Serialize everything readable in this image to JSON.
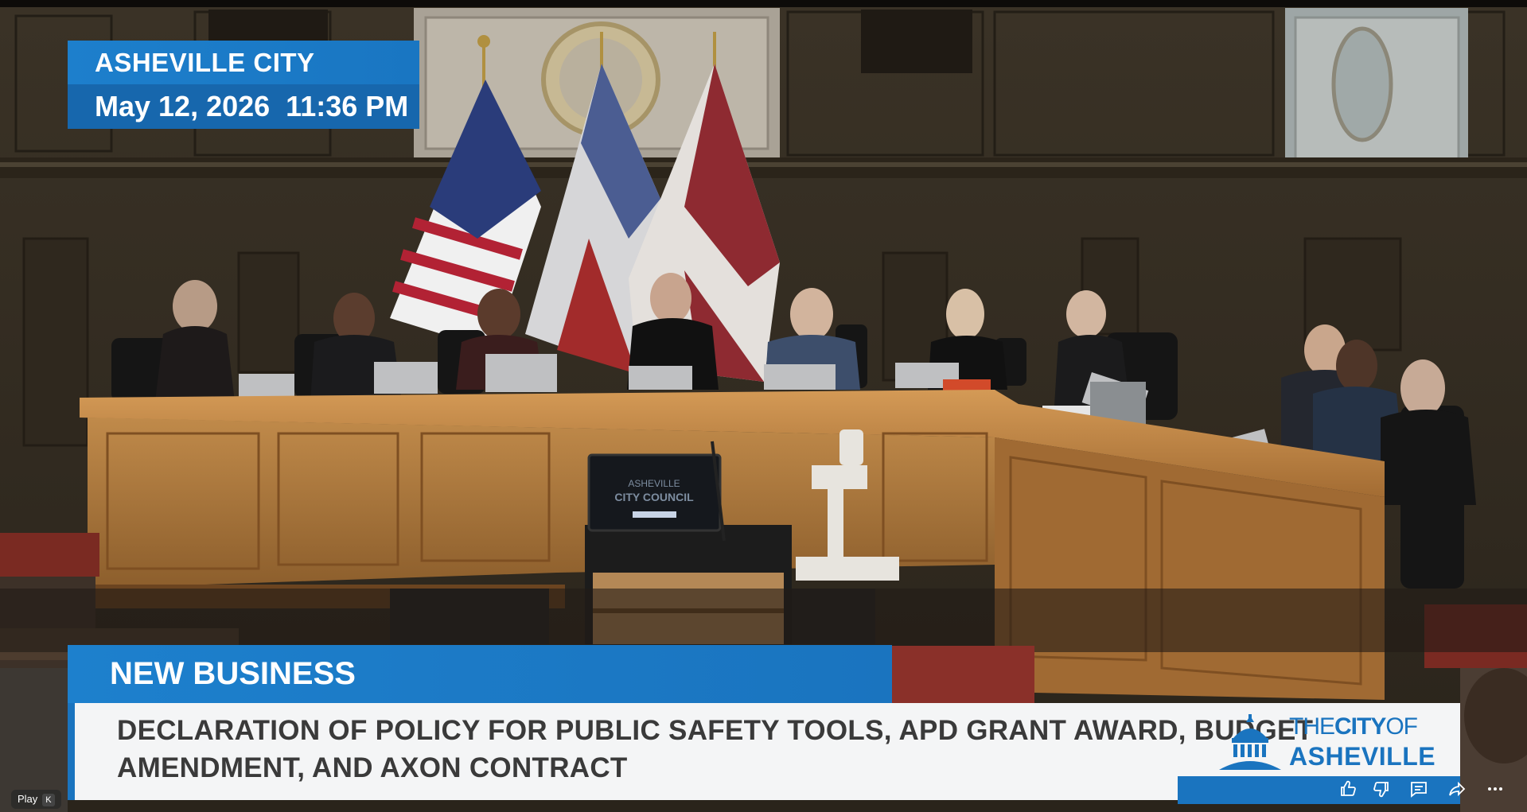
{
  "overlay": {
    "org_name": "ASHEVILLE CITY COUNCIL",
    "date_time": "May 12, 2026  11:36 PM"
  },
  "lower_third": {
    "section": "NEW BUSINESS",
    "title_line1": "DECLARATION OF POLICY FOR PUBLIC SAFETY TOOLS, APD GRANT AWARD, BUDGET",
    "title_line2": "AMENDMENT, AND AXON CONTRACT"
  },
  "logo": {
    "the": "THE",
    "city": "CITY",
    "of": "OF",
    "name": "ASHEVILLE"
  },
  "player": {
    "play_label": "Play",
    "play_shortcut": "K",
    "controls": [
      "thumbs-up-icon",
      "thumbs-down-icon",
      "comment-icon",
      "share-icon",
      "more-icon"
    ]
  },
  "colors": {
    "accent_blue": "#1a74bf",
    "panel_white": "#f4f5f6",
    "title_text": "#3a3a3a"
  }
}
